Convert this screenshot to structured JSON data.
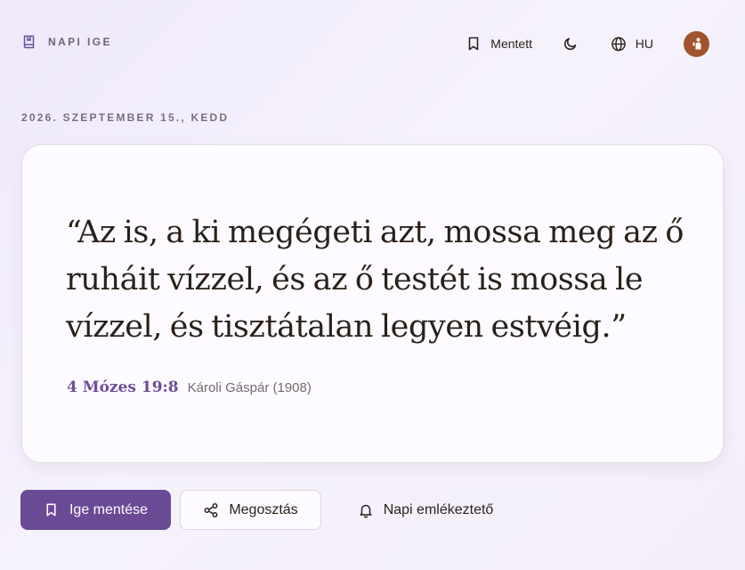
{
  "brand": {
    "label": "NAPI IGE",
    "icon": "book-icon"
  },
  "nav": {
    "saved_label": "Mentett",
    "theme_icon": "moon-icon",
    "language_label": "HU",
    "avatar_icon": "user-avatar"
  },
  "date": "2026. SZEPTEMBER 15., KEDD",
  "verse": {
    "text": "“Az is, a ki megégeti azt, mossa meg az ő ruháit vízzel, és az ő testét is mossa le vízzel, és tisztátalan legyen estvéig.”",
    "reference": "4 Mózes 19:8",
    "translation": "Károli Gáspár (1908)"
  },
  "actions": {
    "save_label": "Ige mentése",
    "share_label": "Megosztás",
    "reminder_label": "Napi emlékeztető"
  },
  "colors": {
    "accent": "#6a4a95",
    "reference": "#6c4f9a",
    "avatar": "#a0532c",
    "background": "#f3eef9"
  }
}
